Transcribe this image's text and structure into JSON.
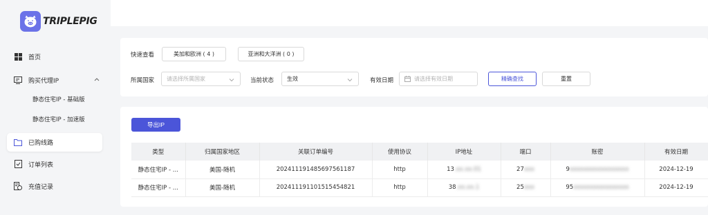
{
  "brand": {
    "name": "TRIPLEPIG"
  },
  "colors": {
    "accent": "#4b55d9",
    "logo_bg": "#6b72e8"
  },
  "sidebar": {
    "items": [
      {
        "label": "首页",
        "icon": "dashboard-icon"
      },
      {
        "label": "购买代理IP",
        "icon": "proxy-icon"
      },
      {
        "label": "已购线路",
        "icon": "folder-icon"
      },
      {
        "label": "订单列表",
        "icon": "order-list-icon"
      },
      {
        "label": "充值记录",
        "icon": "recharge-icon"
      }
    ],
    "subitems": [
      {
        "label": "静态住宅IP - 基础版"
      },
      {
        "label": "静态住宅IP - 加速版"
      }
    ]
  },
  "filters": {
    "quick_label": "快速查看",
    "quick_buttons": [
      "美加和欧洲 ( 4 )",
      "亚洲和大洋洲 ( 0 )"
    ],
    "country_label": "所属国家",
    "country_placeholder": "请选择所属国家",
    "status_label": "当前状态",
    "status_value": "生效",
    "date_label": "有效日期",
    "date_placeholder": "请选择有效日期",
    "search_button": "精确查找",
    "reset_button": "重置"
  },
  "table": {
    "export_button": "导出IP",
    "headers": [
      "类型",
      "归属国家地区",
      "关联订单编号",
      "使用协议",
      "IP地址",
      "端口",
      "账密",
      "有效日期"
    ],
    "rows": [
      [
        "静态住宅IP - ...",
        "美国-随机",
        "20241119148569756118​7",
        "http",
        "13",
        "27",
        "9",
        "2024-12-19"
      ],
      [
        "静态住宅IP - ...",
        "美国-随机",
        "20241119110151545482​1",
        "http",
        "38",
        "25",
        "95",
        "2024-12-19"
      ]
    ]
  }
}
